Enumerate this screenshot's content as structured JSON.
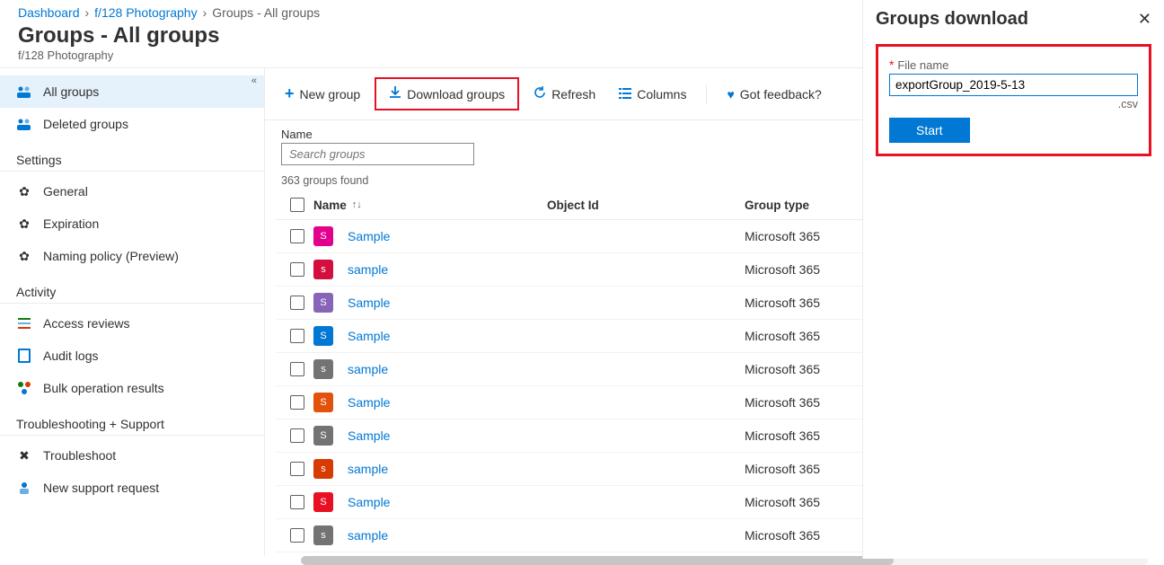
{
  "breadcrumb": {
    "dashboard": "Dashboard",
    "org": "f/128 Photography",
    "current": "Groups - All groups"
  },
  "page": {
    "title": "Groups - All groups",
    "subtitle": "f/128 Photography"
  },
  "sidebar": {
    "nav": [
      {
        "label": "All groups",
        "active": true
      },
      {
        "label": "Deleted groups",
        "active": false
      }
    ],
    "sections": {
      "settings": {
        "head": "Settings",
        "items": [
          "General",
          "Expiration",
          "Naming policy (Preview)"
        ]
      },
      "activity": {
        "head": "Activity",
        "items": [
          "Access reviews",
          "Audit logs",
          "Bulk operation results"
        ]
      },
      "support": {
        "head": "Troubleshooting + Support",
        "items": [
          "Troubleshoot",
          "New support request"
        ]
      }
    }
  },
  "toolbar": {
    "new_group": "New group",
    "download_groups": "Download groups",
    "refresh": "Refresh",
    "columns": "Columns",
    "feedback": "Got feedback?"
  },
  "filter": {
    "label": "Name",
    "placeholder": "Search groups"
  },
  "count_text": "363 groups found",
  "table": {
    "headers": {
      "name": "Name",
      "object_id": "Object Id",
      "group_type": "Group type"
    },
    "sort_icon": "↑↓",
    "rows": [
      {
        "initial": "S",
        "color": "#e3008c",
        "name": "Sample",
        "type": "Microsoft 365"
      },
      {
        "initial": "s",
        "color": "#d40f3f",
        "name": "sample",
        "type": "Microsoft 365"
      },
      {
        "initial": "S",
        "color": "#8764b8",
        "name": "Sample",
        "type": "Microsoft 365"
      },
      {
        "initial": "S",
        "color": "#0078d4",
        "name": "Sample",
        "type": "Microsoft 365"
      },
      {
        "initial": "s",
        "color": "#737373",
        "name": "sample",
        "type": "Microsoft 365"
      },
      {
        "initial": "S",
        "color": "#e3520b",
        "name": "Sample",
        "type": "Microsoft 365"
      },
      {
        "initial": "S",
        "color": "#737373",
        "name": "Sample",
        "type": "Microsoft 365"
      },
      {
        "initial": "s",
        "color": "#d83b01",
        "name": "sample",
        "type": "Microsoft 365"
      },
      {
        "initial": "S",
        "color": "#e81123",
        "name": "Sample",
        "type": "Microsoft 365"
      },
      {
        "initial": "s",
        "color": "#737373",
        "name": "sample",
        "type": "Microsoft 365"
      }
    ]
  },
  "panel": {
    "title": "Groups download",
    "field_label": "File name",
    "file_name_value": "exportGroup_2019-5-13",
    "extension": ".csv",
    "start_label": "Start"
  }
}
